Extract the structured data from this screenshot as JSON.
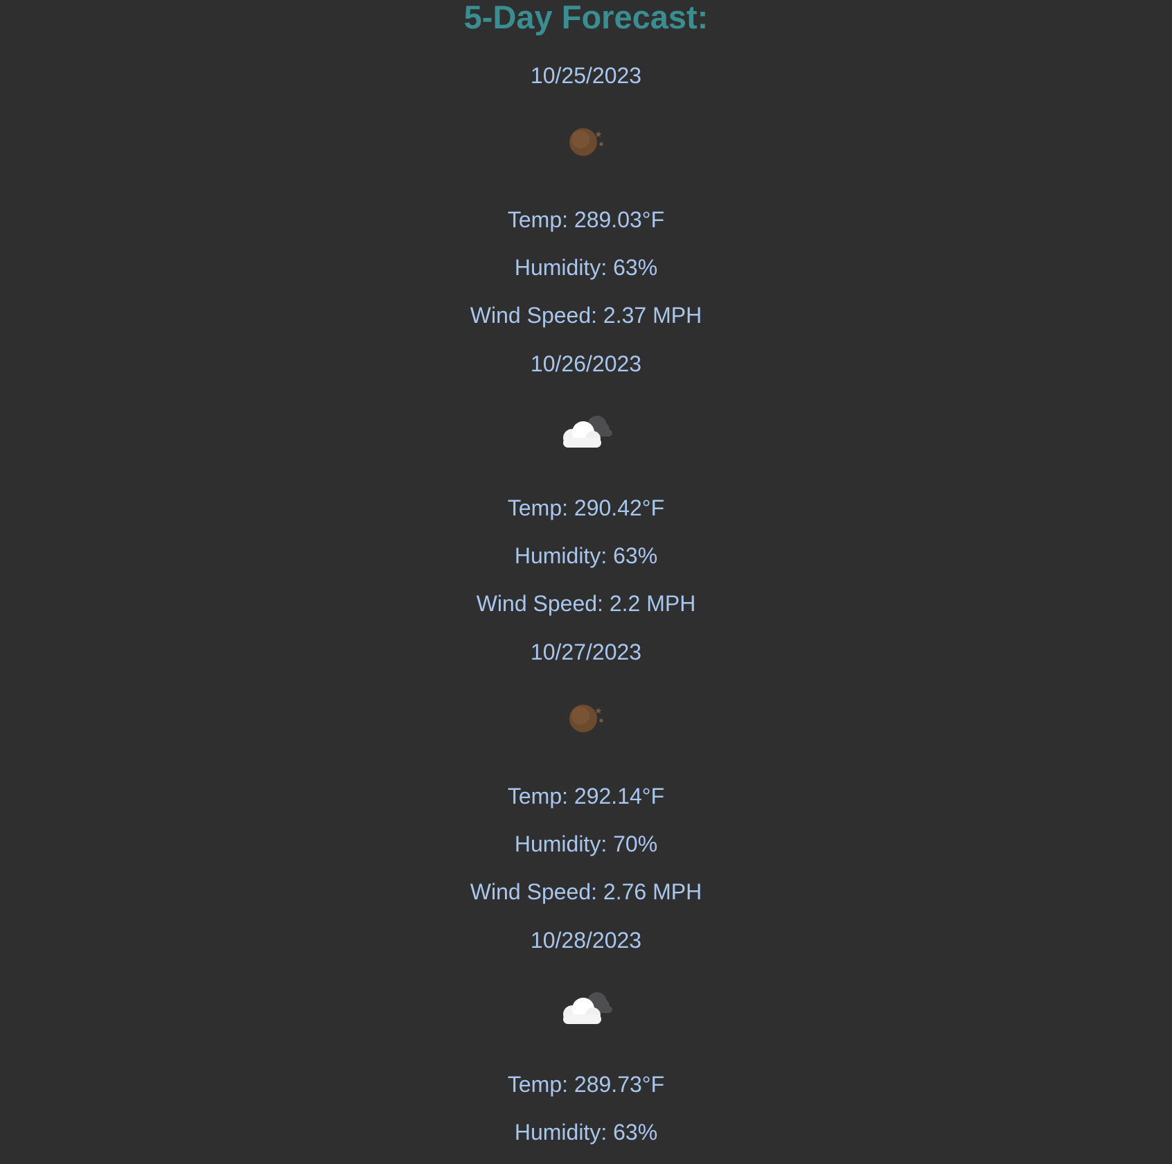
{
  "forecast": {
    "title": "5-Day Forecast:",
    "days": [
      {
        "date": "10/25/2023",
        "icon": "moon-night-icon",
        "temp": "Temp: 289.03°F",
        "humidity": "Humidity: 63%",
        "wind": "Wind Speed: 2.37 MPH"
      },
      {
        "date": "10/26/2023",
        "icon": "cloud-moon-icon",
        "temp": "Temp: 290.42°F",
        "humidity": "Humidity: 63%",
        "wind": "Wind Speed: 2.2 MPH"
      },
      {
        "date": "10/27/2023",
        "icon": "moon-night-icon",
        "temp": "Temp: 292.14°F",
        "humidity": "Humidity: 70%",
        "wind": "Wind Speed: 2.76 MPH"
      },
      {
        "date": "10/28/2023",
        "icon": "cloud-moon-icon",
        "temp": "Temp: 289.73°F",
        "humidity": "Humidity: 63%"
      }
    ]
  },
  "colors": {
    "background": "#2f2f30",
    "heading": "#3a8d90",
    "text": "#a9c6ee"
  }
}
